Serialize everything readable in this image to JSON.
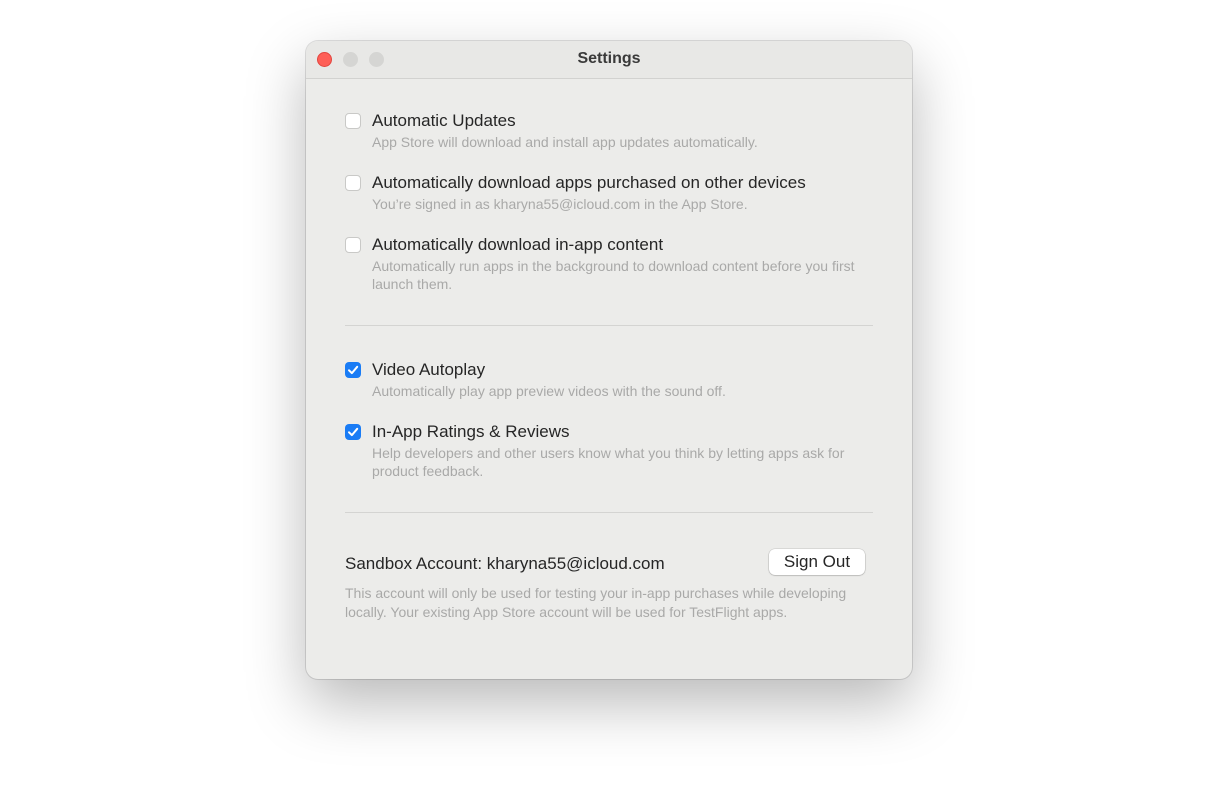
{
  "window": {
    "title": "Settings"
  },
  "options_group1": [
    {
      "title": "Automatic Updates",
      "description": "App Store will download and install app updates automatically.",
      "checked": false
    },
    {
      "title": "Automatically download apps purchased on other devices",
      "description": "You’re signed in as kharyna55@icloud.com in the App Store.",
      "checked": false
    },
    {
      "title": "Automatically download in-app content",
      "description": "Automatically run apps in the background to download content before you first launch them.",
      "checked": false
    }
  ],
  "options_group2": [
    {
      "title": "Video Autoplay",
      "description": "Automatically play app preview videos with the sound off.",
      "checked": true
    },
    {
      "title": "In-App Ratings & Reviews",
      "description": "Help developers and other users know what you think by letting apps ask for product feedback.",
      "checked": true
    }
  ],
  "sandbox": {
    "label": "Sandbox Account: kharyna55@icloud.com",
    "button_label": "Sign Out",
    "description": "This account will only be used for testing your in-app purchases while developing locally. Your existing App Store account will be used for TestFlight apps."
  },
  "colors": {
    "accent": "#1a7cf5",
    "close": "#fe5f57"
  }
}
